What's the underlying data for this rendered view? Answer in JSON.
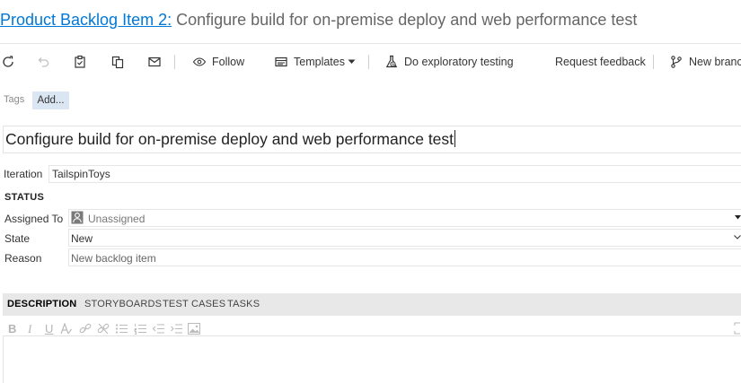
{
  "header": {
    "link": "Product Backlog Item 2:",
    "title": " Configure build for on-premise deploy and web performance test"
  },
  "toolbar": {
    "follow": "Follow",
    "templates": "Templates",
    "exploratory": "Do exploratory testing",
    "feedback": "Request feedback",
    "new_branch": "New branch"
  },
  "tags": {
    "label": "Tags",
    "add": "Add..."
  },
  "work_item": {
    "title": "Configure build for on-premise deploy and web performance test"
  },
  "iteration": {
    "label": "Iteration",
    "value": "TailspinToys"
  },
  "status": {
    "header": "STATUS",
    "assigned_label": "Assigned To",
    "assigned_value": "Unassigned",
    "state_label": "State",
    "state_value": "New",
    "reason_label": "Reason",
    "reason_value": "New backlog item"
  },
  "tabs": [
    "DESCRIPTION",
    "STORYBOARDS",
    "TEST CASES",
    "TASKS"
  ],
  "editor_toolbar": {
    "bold": "B",
    "italic": "I",
    "underline": "U"
  }
}
